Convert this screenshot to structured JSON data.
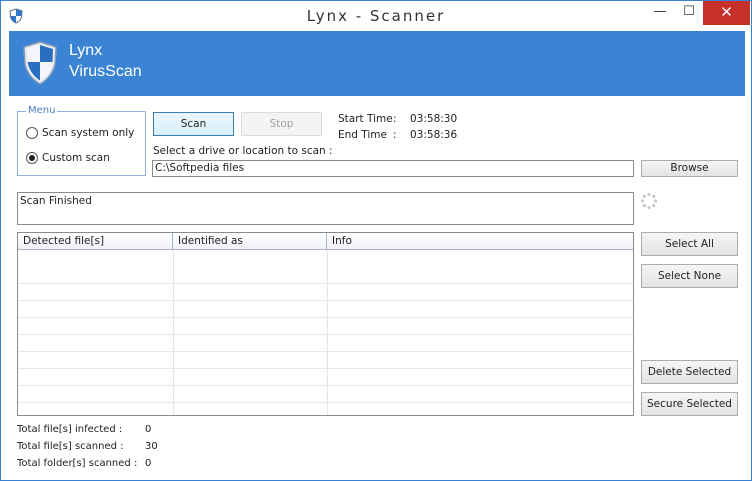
{
  "window": {
    "title": "Lynx - Scanner",
    "controls": {
      "minimize": "—",
      "maximize": "☐",
      "close": "✕"
    }
  },
  "banner": {
    "line1": "Lynx",
    "line2": "VirusScan",
    "color": "#3b84d4"
  },
  "menu": {
    "legend": "Menu",
    "options": [
      {
        "label": "Scan system only",
        "selected": false
      },
      {
        "label": "Custom scan",
        "selected": true
      }
    ]
  },
  "actions": {
    "scan": "Scan",
    "stop": "Stop",
    "browse": "Browse"
  },
  "times": {
    "start_label": "Start Time",
    "start_sep": ":",
    "start_value": "03:58:30",
    "end_label": "End Time",
    "end_sep": ":",
    "end_value": "03:58:36"
  },
  "location": {
    "prompt": "Select a drive or location to scan :",
    "path": "C:\\Softpedia files"
  },
  "status": {
    "text": "Scan Finished"
  },
  "results": {
    "columns": [
      "Detected file[s]",
      "Identified as",
      "Info"
    ],
    "rows": []
  },
  "side_buttons": {
    "select_all": "Select All",
    "select_none": "Select None",
    "delete_selected": "Delete Selected",
    "secure_selected": "Secure Selected"
  },
  "stats": {
    "infected_label": "Total file[s] infected :",
    "infected_value": "0",
    "scanned_label": "Total file[s] scanned :",
    "scanned_value": "30",
    "folders_label": "Total folder[s] scanned :",
    "folders_value": "0"
  }
}
